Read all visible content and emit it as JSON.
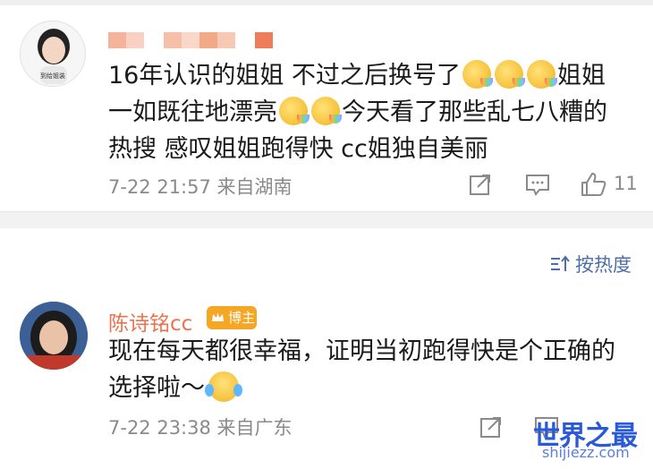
{
  "comments": [
    {
      "avatar_caption": "到给姐装",
      "author": "",
      "text_part1": "16年认识的姐姐 不过之后换号了",
      "text_part2": "姐姐",
      "text_part3": "一如既往地漂亮",
      "text_part4": "今天看了那些乱七八糟的",
      "text_part5": "热搜 感叹姐姐跑得快 cc姐独自美丽",
      "meta": "7-22 21:57 来自湖南",
      "like_count": "11"
    },
    {
      "author": "陈诗铭cc",
      "badge": "博主",
      "text_line1": "现在每天都很幸福，证明当初跑得快是个正确的",
      "text_line2": "选择啦～",
      "meta": "7-22 23:38 来自广东"
    }
  ],
  "sort": {
    "label": "按热度"
  },
  "watermark": {
    "title": "世界之最",
    "url": "shijiezz.com"
  },
  "icons": [
    "share-icon",
    "comment-icon",
    "like-icon",
    "sort-icon",
    "crown-icon"
  ],
  "colors": {
    "nickname": "#eb7350",
    "badge": "#f5a623",
    "link_blue": "#4e6ea8",
    "meta_gray": "#8a8a8a"
  }
}
